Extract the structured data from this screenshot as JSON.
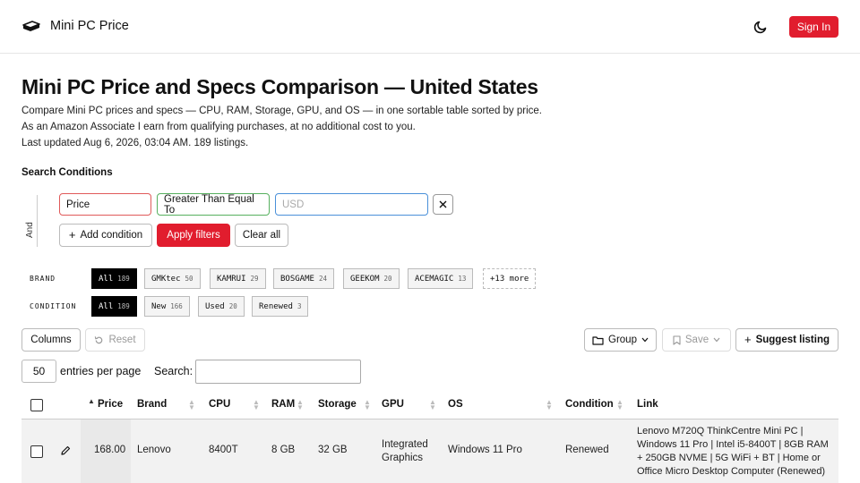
{
  "header": {
    "site_name": "Mini PC Price",
    "signin_label": "Sign In"
  },
  "intro": {
    "title": "Mini PC Price and Specs Comparison — United States",
    "line1": "Compare Mini PC prices and specs — CPU, RAM, Storage, GPU, and OS — in one sortable table sorted by price.",
    "line2": "As an Amazon Associate I earn from qualifying purchases, at no additional cost to you.",
    "line3": "Last updated Aug 6, 2026, 03:04 AM. 189 listings."
  },
  "filters": {
    "heading": "Search Conditions",
    "and_label": "And",
    "field_value": "Price",
    "operator_value": "Greater Than Equal To",
    "value_placeholder": "USD",
    "add_label": "Add condition",
    "apply_label": "Apply filters",
    "clear_label": "Clear all"
  },
  "facets": {
    "brand_label": "BRAND",
    "brand_chips": [
      {
        "label": "All",
        "count": "189"
      },
      {
        "label": "GMKtec",
        "count": "50"
      },
      {
        "label": "KAMRUI",
        "count": "29"
      },
      {
        "label": "BOSGAME",
        "count": "24"
      },
      {
        "label": "GEEKOM",
        "count": "20"
      },
      {
        "label": "ACEMAGIC",
        "count": "13"
      }
    ],
    "brand_more": "+13 more",
    "condition_label": "CONDITION",
    "condition_chips": [
      {
        "label": "All",
        "count": "189"
      },
      {
        "label": "New",
        "count": "166"
      },
      {
        "label": "Used",
        "count": "20"
      },
      {
        "label": "Renewed",
        "count": "3"
      }
    ]
  },
  "toolbar": {
    "columns_label": "Columns",
    "reset_label": "Reset",
    "group_label": "Group",
    "save_label": "Save",
    "suggest_label": "Suggest listing"
  },
  "table_controls": {
    "entries_value": "50",
    "entries_label": "entries per page",
    "search_label": "Search:"
  },
  "table": {
    "columns": [
      "Price",
      "Brand",
      "CPU",
      "RAM",
      "Storage",
      "GPU",
      "OS",
      "Condition",
      "Link"
    ],
    "rows": [
      {
        "price": "168.00",
        "brand": "Lenovo",
        "cpu": "8400T",
        "ram": "8 GB",
        "storage": "32 GB",
        "gpu": "Integrated Graphics",
        "os": "Windows 11 Pro",
        "condition": "Renewed",
        "link": "Lenovo M720Q ThinkCentre Mini PC | Windows 11 Pro | Intel i5-8400T | 8GB RAM + 250GB NVME | 5G WiFi + BT | Home or Office Micro Desktop Computer (Renewed)"
      }
    ]
  }
}
